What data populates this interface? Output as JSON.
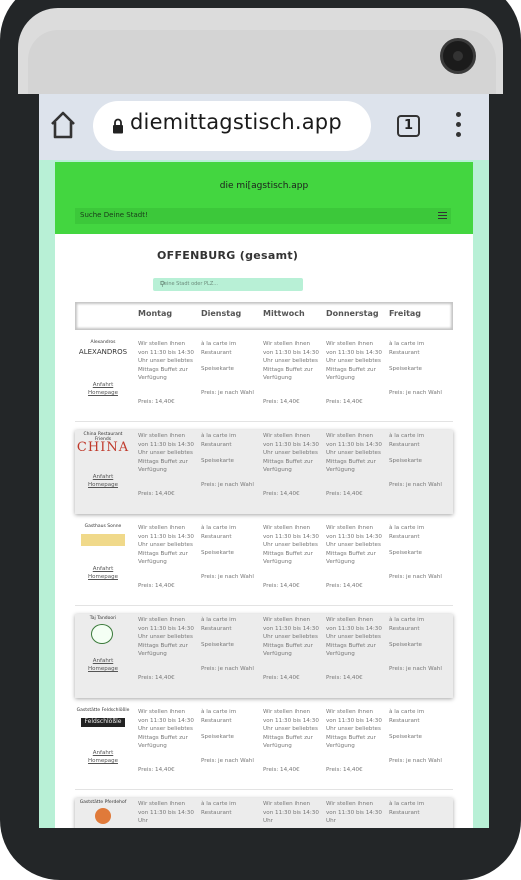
{
  "browser": {
    "url": "diemittagstisch.app",
    "tab_count": "1"
  },
  "site": {
    "logo_text": "die mi[agstisch.app",
    "city_search_label": "Suche Deine Stadt!"
  },
  "page": {
    "title": "OFFENBURG  (gesamt)",
    "search_placeholder": "Deine Stadt oder PLZ..."
  },
  "table": {
    "columns": [
      "Montag",
      "Dienstag",
      "Mittwoch",
      "Donnerstag",
      "Freitag"
    ],
    "link_labels": {
      "directions": "Anfahrt",
      "homepage": "Homepage"
    },
    "rows": [
      {
        "name": "Alexandros",
        "logo_text": "ALEXANDROS",
        "cells": [
          {
            "text": "Wir stellen ihnen von 11:30 bis 14:30 Uhr unser beliebtes Mittags Buffet zur Verfügung",
            "price": "Preis: 14,40€"
          },
          {
            "text": "à la carte im Restaurant",
            "mid": "Speisekarte",
            "price": "Preis: je nach Wahl"
          },
          {
            "text": "Wir stellen ihnen von 11:30 bis 14:30 Uhr unser beliebtes Mittags Buffet zur Verfügung",
            "price": "Preis: 14,40€"
          },
          {
            "text": "Wir stellen ihnen von 11:30 bis 14:30 Uhr unser beliebtes Mittags Buffet zur Verfügung",
            "price": "Preis: 14,40€"
          },
          {
            "text": "à la carte im Restaurant",
            "mid": "Speisekarte",
            "price": "Preis: je nach Wahl"
          }
        ]
      },
      {
        "name": "China Restaurant Friends",
        "logo_text": "CHINA",
        "cells": [
          {
            "text": "Wir stellen ihnen von 11:30 bis 14:30 Uhr unser beliebtes Mittags Buffet zur Verfügung",
            "price": "Preis: 14,40€"
          },
          {
            "text": "à la carte im Restaurant",
            "mid": "Speisekarte",
            "price": "Preis: je nach Wahl"
          },
          {
            "text": "Wir stellen ihnen von 11:30 bis 14:30 Uhr unser beliebtes Mittags Buffet zur Verfügung",
            "price": "Preis: 14,40€"
          },
          {
            "text": "Wir stellen ihnen von 11:30 bis 14:30 Uhr unser beliebtes Mittags Buffet zur Verfügung",
            "price": "Preis: 14,40€"
          },
          {
            "text": "à la carte im Restaurant",
            "mid": "Speisekarte",
            "price": "Preis: je nach Wahl"
          }
        ]
      },
      {
        "name": "Gasthaus Sonne",
        "logo_text": "",
        "cells": [
          {
            "text": "Wir stellen ihnen von 11:30 bis 14:30 Uhr unser beliebtes Mittags Buffet zur Verfügung",
            "price": "Preis: 14,40€"
          },
          {
            "text": "à la carte im Restaurant",
            "mid": "Speisekarte",
            "price": "Preis: je nach Wahl"
          },
          {
            "text": "Wir stellen ihnen von 11:30 bis 14:30 Uhr unser beliebtes Mittags Buffet zur Verfügung",
            "price": "Preis: 14,40€"
          },
          {
            "text": "Wir stellen ihnen von 11:30 bis 14:30 Uhr unser beliebtes Mittags Buffet zur Verfügung",
            "price": "Preis: 14,40€"
          },
          {
            "text": "à la carte im Restaurant",
            "mid": "Speisekarte",
            "price": "Preis: je nach Wahl"
          }
        ]
      },
      {
        "name": "Taj Tandoori",
        "logo_text": "",
        "cells": [
          {
            "text": "Wir stellen ihnen von 11:30 bis 14:30 Uhr unser beliebtes Mittags Buffet zur Verfügung",
            "price": "Preis: 14,40€"
          },
          {
            "text": "à la carte im Restaurant",
            "mid": "Speisekarte",
            "price": "Preis: je nach Wahl"
          },
          {
            "text": "Wir stellen ihnen von 11:30 bis 14:30 Uhr unser beliebtes Mittags Buffet zur Verfügung",
            "price": "Preis: 14,40€"
          },
          {
            "text": "Wir stellen ihnen von 11:30 bis 14:30 Uhr unser beliebtes Mittags Buffet zur Verfügung",
            "price": "Preis: 14,40€"
          },
          {
            "text": "à la carte im Restaurant",
            "mid": "Speisekarte",
            "price": "Preis: je nach Wahl"
          }
        ]
      },
      {
        "name": "Gaststätte Feldschlößle",
        "logo_text": "Feldschlößle",
        "cells": [
          {
            "text": "Wir stellen ihnen von 11:30 bis 14:30 Uhr unser beliebtes Mittags Buffet zur Verfügung",
            "price": "Preis: 14,40€"
          },
          {
            "text": "à la carte im Restaurant",
            "mid": "Speisekarte",
            "price": "Preis: je nach Wahl"
          },
          {
            "text": "Wir stellen ihnen von 11:30 bis 14:30 Uhr unser beliebtes Mittags Buffet zur Verfügung",
            "price": "Preis: 14,40€"
          },
          {
            "text": "Wir stellen ihnen von 11:30 bis 14:30 Uhr unser beliebtes Mittags Buffet zur Verfügung",
            "price": "Preis: 14,40€"
          },
          {
            "text": "à la carte im Restaurant",
            "mid": "Speisekarte",
            "price": "Preis: je nach Wahl"
          }
        ]
      },
      {
        "name": "Gaststätte Pferdehof",
        "logo_text": "",
        "cells": [
          {
            "text": "Wir stellen ihnen von 11:30 bis 14:30 Uhr",
            "price": ""
          },
          {
            "text": "à la carte im Restaurant",
            "mid": "",
            "price": ""
          },
          {
            "text": "Wir stellen ihnen von 11:30 bis 14:30 Uhr",
            "price": ""
          },
          {
            "text": "Wir stellen ihnen von 11:30 bis 14:30 Uhr",
            "price": ""
          },
          {
            "text": "à la carte im Restaurant",
            "mid": "",
            "price": ""
          }
        ]
      }
    ]
  },
  "colors": {
    "brand_green": "#43d640",
    "mint_background": "#b8f0d6"
  }
}
